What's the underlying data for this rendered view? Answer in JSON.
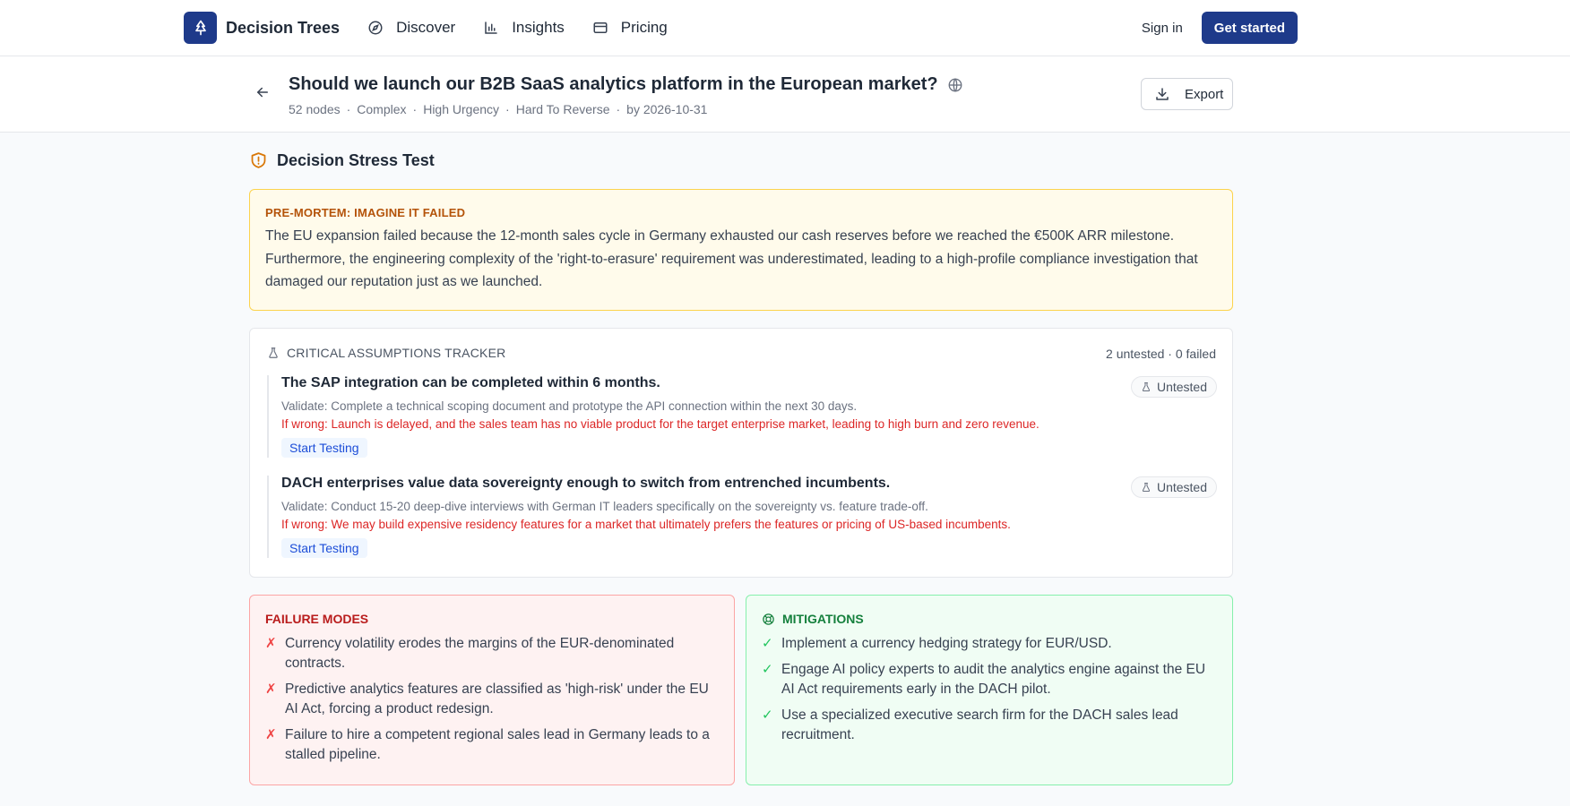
{
  "nav": {
    "brand": "Decision Trees",
    "links": [
      {
        "label": "Discover",
        "icon": "compass-icon"
      },
      {
        "label": "Insights",
        "icon": "bar-chart-icon"
      },
      {
        "label": "Pricing",
        "icon": "credit-card-icon"
      }
    ],
    "sign_in": "Sign in",
    "get_started": "Get started",
    "accent": "#1e3a8a"
  },
  "header": {
    "title": "Should we launch our B2B SaaS analytics platform in the European market?",
    "meta": [
      "52 nodes",
      "Complex",
      "High Urgency",
      "Hard To Reverse",
      "by 2026-10-31"
    ],
    "export_label": "Export"
  },
  "stress_test": {
    "title": "Decision Stress Test",
    "premortem": {
      "label": "PRE-MORTEM: IMAGINE IT FAILED",
      "text": "The EU expansion failed because the 12-month sales cycle in Germany exhausted our cash reserves before we reached the €500K ARR milestone. Furthermore, the engineering complexity of the 'right-to-erasure' requirement was underestimated, leading to a high-profile compliance investigation that damaged our reputation just as we launched."
    },
    "assumptions": {
      "label": "CRITICAL ASSUMPTIONS TRACKER",
      "count": "2 untested · 0 failed",
      "items": [
        {
          "title": "The SAP integration can be completed within 6 months.",
          "validate": "Validate: Complete a technical scoping document and prototype the API connection within the next 30 days.",
          "wrong": "If wrong: Launch is delayed, and the sales team has no viable product for the target enterprise market, leading to high burn and zero revenue.",
          "status": "Untested",
          "button": "Start Testing"
        },
        {
          "title": "DACH enterprises value data sovereignty enough to switch from entrenched incumbents.",
          "validate": "Validate: Conduct 15-20 deep-dive interviews with German IT leaders specifically on the sovereignty vs. feature trade-off.",
          "wrong": "If wrong: We may build expensive residency features for a market that ultimately prefers the features or pricing of US-based incumbents.",
          "status": "Untested",
          "button": "Start Testing"
        }
      ]
    },
    "failure_modes": {
      "label": "FAILURE MODES",
      "mark": "✗",
      "items": [
        "Currency volatility erodes the margins of the EUR-denominated contracts.",
        "Predictive analytics features are classified as 'high-risk' under the EU AI Act, forcing a product redesign.",
        "Failure to hire a competent regional sales lead in Germany leads to a stalled pipeline."
      ]
    },
    "mitigations": {
      "label": "MITIGATIONS",
      "mark": "✓",
      "items": [
        "Implement a currency hedging strategy for EUR/USD.",
        "Engage AI policy experts to audit the analytics engine against the EU AI Act requirements early in the DACH pilot.",
        "Use a specialized executive search firm for the DACH sales lead recruitment."
      ]
    }
  }
}
